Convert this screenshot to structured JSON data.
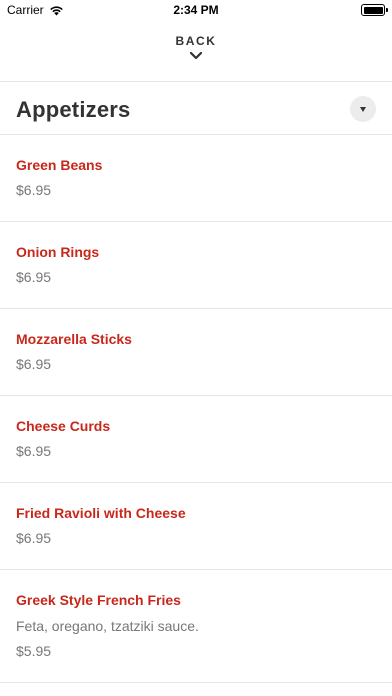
{
  "status_bar": {
    "carrier": "Carrier",
    "time": "2:34 PM"
  },
  "nav": {
    "back_label": "BACK"
  },
  "category": {
    "title": "Appetizers"
  },
  "items": [
    {
      "name": "Green Beans",
      "price": "$6.95"
    },
    {
      "name": "Onion Rings",
      "price": "$6.95"
    },
    {
      "name": "Mozzarella Sticks",
      "price": "$6.95"
    },
    {
      "name": "Cheese Curds",
      "price": "$6.95"
    },
    {
      "name": "Fried Ravioli with Cheese",
      "price": "$6.95"
    },
    {
      "name": "Greek Style French Fries",
      "description": "Feta, oregano, tzatziki sauce.",
      "price": "$5.95"
    }
  ],
  "colors": {
    "item_name": "#c8281c",
    "text_secondary": "#777777",
    "divider": "#e6e6e6"
  }
}
